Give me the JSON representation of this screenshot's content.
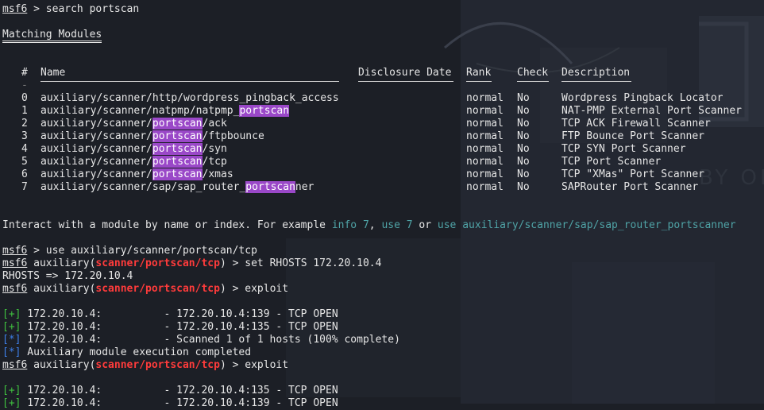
{
  "terminal": {
    "prompt_user": "msf6",
    "prompt_sep": " > ",
    "search_cmd": "search portscan",
    "matching_title": "Matching Modules",
    "headers": {
      "num": "#",
      "name": "Name",
      "date": "Disclosure Date",
      "rank": "Rank",
      "check": "Check",
      "desc": "Description"
    },
    "minus_row": "-",
    "modules": [
      {
        "num": "0",
        "pre": "auxiliary/scanner/http/wordpress_pingback_access",
        "hl": "",
        "post": "",
        "rank": "normal",
        "check": "No",
        "desc": "Wordpress Pingback Locator"
      },
      {
        "num": "1",
        "pre": "auxiliary/scanner/natpmp/natpmp_",
        "hl": "portscan",
        "post": "",
        "rank": "normal",
        "check": "No",
        "desc": "NAT-PMP External Port Scanner"
      },
      {
        "num": "2",
        "pre": "auxiliary/scanner/",
        "hl": "portscan",
        "post": "/ack",
        "rank": "normal",
        "check": "No",
        "desc": "TCP ACK Firewall Scanner"
      },
      {
        "num": "3",
        "pre": "auxiliary/scanner/",
        "hl": "portscan",
        "post": "/ftpbounce",
        "rank": "normal",
        "check": "No",
        "desc": "FTP Bounce Port Scanner"
      },
      {
        "num": "4",
        "pre": "auxiliary/scanner/",
        "hl": "portscan",
        "post": "/syn",
        "rank": "normal",
        "check": "No",
        "desc": "TCP SYN Port Scanner"
      },
      {
        "num": "5",
        "pre": "auxiliary/scanner/",
        "hl": "portscan",
        "post": "/tcp",
        "rank": "normal",
        "check": "No",
        "desc": "TCP Port Scanner"
      },
      {
        "num": "6",
        "pre": "auxiliary/scanner/",
        "hl": "portscan",
        "post": "/xmas",
        "rank": "normal",
        "check": "No",
        "desc": "TCP \"XMas\" Port Scanner"
      },
      {
        "num": "7",
        "pre": "auxiliary/scanner/sap/sap_router_",
        "hl": "portscan",
        "post": "ner",
        "rank": "normal",
        "check": "No",
        "desc": "SAPRouter Port Scanner"
      }
    ],
    "interact": {
      "t1": "Interact with a module by name or index. For example ",
      "c1": "info 7",
      "t2": ", ",
      "c2": "use 7",
      "t3": " or ",
      "c3": "use auxiliary/scanner/sap/sap_router_portscanner"
    },
    "use_cmd": "use auxiliary/scanner/portscan/tcp",
    "aux_word": " auxiliary(",
    "module_path": "scanner/portscan/tcp",
    "aux_close": ") > ",
    "set_cmd": "set RHOSTS 172.20.10.4",
    "rhosts_out": "RHOSTS => 172.20.10.4",
    "exploit_cmd": "exploit",
    "run1": [
      {
        "tag": "[+]",
        "type": "ok",
        "text": " 172.20.10.4:          - 172.20.10.4:139 - TCP OPEN"
      },
      {
        "tag": "[+]",
        "type": "ok",
        "text": " 172.20.10.4:          - 172.20.10.4:135 - TCP OPEN"
      },
      {
        "tag": "[*]",
        "type": "info",
        "text": " 172.20.10.4:          - Scanned 1 of 1 hosts (100% complete)"
      },
      {
        "tag": "[*]",
        "type": "info",
        "text": " Auxiliary module execution completed"
      }
    ],
    "run2": [
      {
        "tag": "[+]",
        "type": "ok",
        "text": " 172.20.10.4:          - 172.20.10.4:135 - TCP OPEN"
      },
      {
        "tag": "[+]",
        "type": "ok",
        "text": " 172.20.10.4:          - 172.20.10.4:139 - TCP OPEN"
      }
    ]
  }
}
